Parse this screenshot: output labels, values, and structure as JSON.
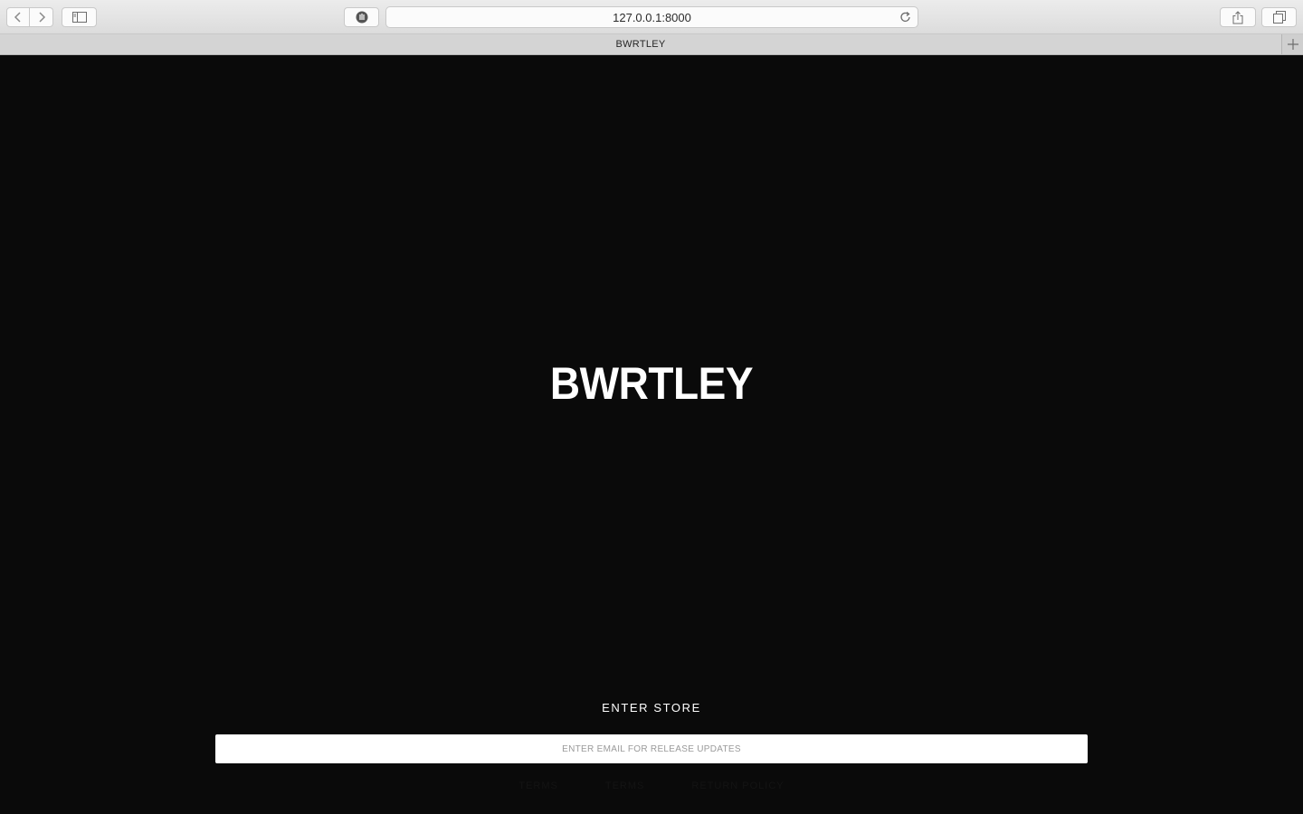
{
  "browser": {
    "url": "127.0.0.1:8000",
    "tab_title": "BWRTLEY",
    "icons": {
      "back": "chevron-left-icon",
      "forward": "chevron-right-icon",
      "sidebar": "sidebar-icon",
      "privacy": "privacy-report-icon",
      "reload": "reload-icon",
      "share": "share-icon",
      "tabs": "tabs-overview-icon",
      "new_tab": "plus-icon"
    }
  },
  "page": {
    "logo": "BWRTLEY",
    "enter_store": "ENTER STORE",
    "email_placeholder": "ENTER EMAIL FOR RELEASE UPDATES",
    "footer_links": [
      "TERMS",
      "TERMS",
      "RETURN POLICY"
    ],
    "colors": {
      "background": "#0a0a0a",
      "text": "#ffffff",
      "input_bg": "#ffffff"
    }
  }
}
